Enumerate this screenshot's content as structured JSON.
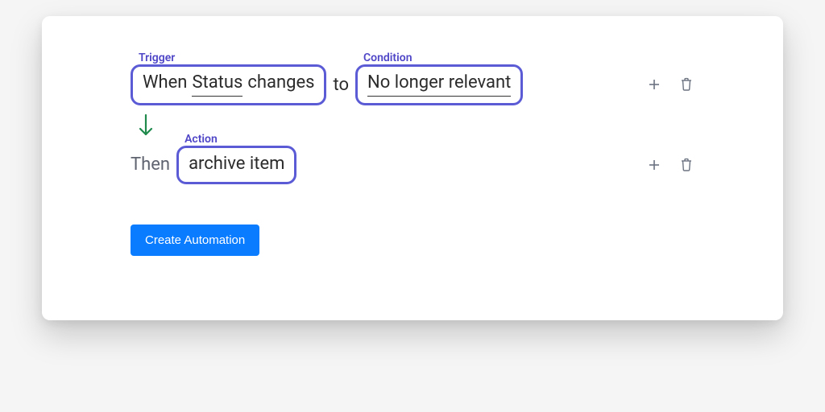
{
  "labels": {
    "trigger": "Trigger",
    "condition": "Condition",
    "action": "Action"
  },
  "trigger": {
    "prefix": "When",
    "field": "Status",
    "verb": "changes"
  },
  "connector_to": "to",
  "condition": {
    "value": "No longer relevant"
  },
  "then": "Then",
  "action": {
    "value": "archive item"
  },
  "button": {
    "create": "Create Automation"
  },
  "colors": {
    "chip_border": "#5b5bd6",
    "label": "#4f46c7",
    "primary": "#0a7cff",
    "arrow": "#1f8a4c"
  }
}
